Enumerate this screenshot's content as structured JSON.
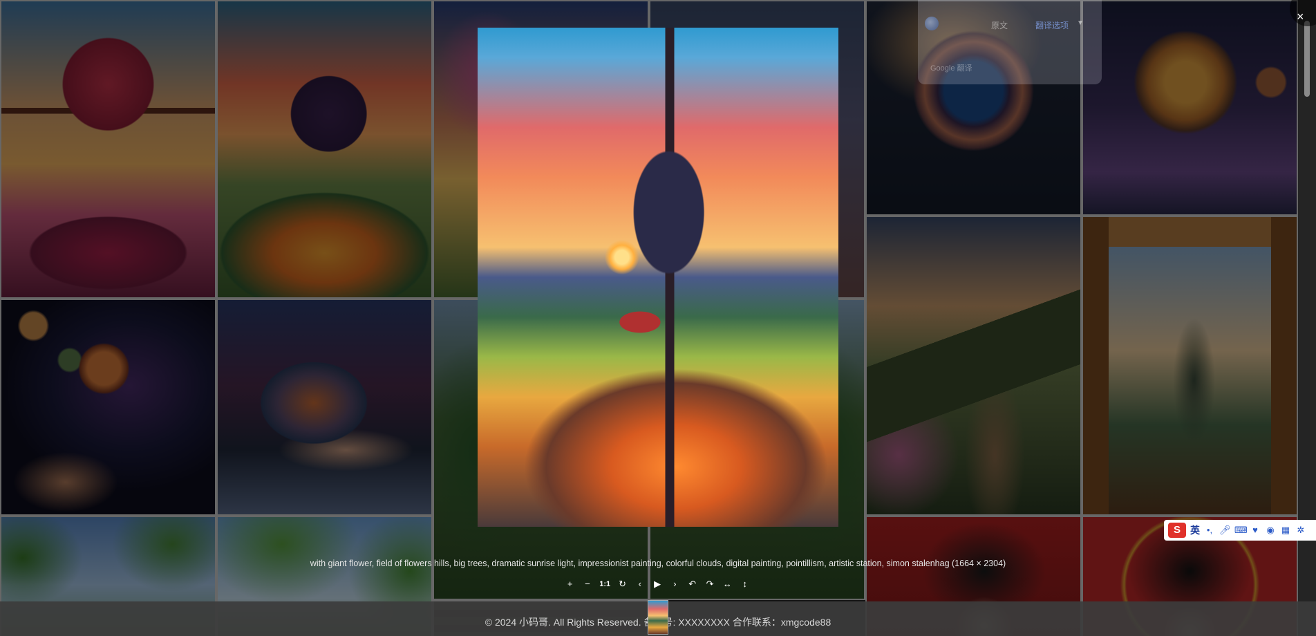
{
  "translate_popup": {
    "original_label": "原文",
    "options_label": "翻译选项",
    "provider_label": "Google 翻译"
  },
  "viewer": {
    "caption": "with giant flower, field of flowers hills, big trees, dramatic sunrise light, impressionist painting, colorful clouds, digital painting, pointillism, artistic station, simon stalenhag (1664 × 2304)",
    "toolbar": {
      "zoom_in": "+",
      "zoom_out": "−",
      "one_to_one": "1:1",
      "reset": "↻",
      "prev": "‹",
      "play": "▶",
      "next": "›",
      "rotate_left": "↶",
      "rotate_right": "↷",
      "flip_horizontal": "↔",
      "flip_vertical": "↕"
    },
    "close": "×"
  },
  "footer": {
    "text": "© 2024 小码哥. All Rights Reserved. 备案号: XXXXXXXX   合作联系：xmgcode88"
  },
  "ime": {
    "logo": "S",
    "lang": "英",
    "icons": [
      "punctuation-icon",
      "microphone-icon",
      "keyboard-icon",
      "skin-icon",
      "gamepad-icon",
      "grid-icon",
      "settings-icon"
    ]
  }
}
